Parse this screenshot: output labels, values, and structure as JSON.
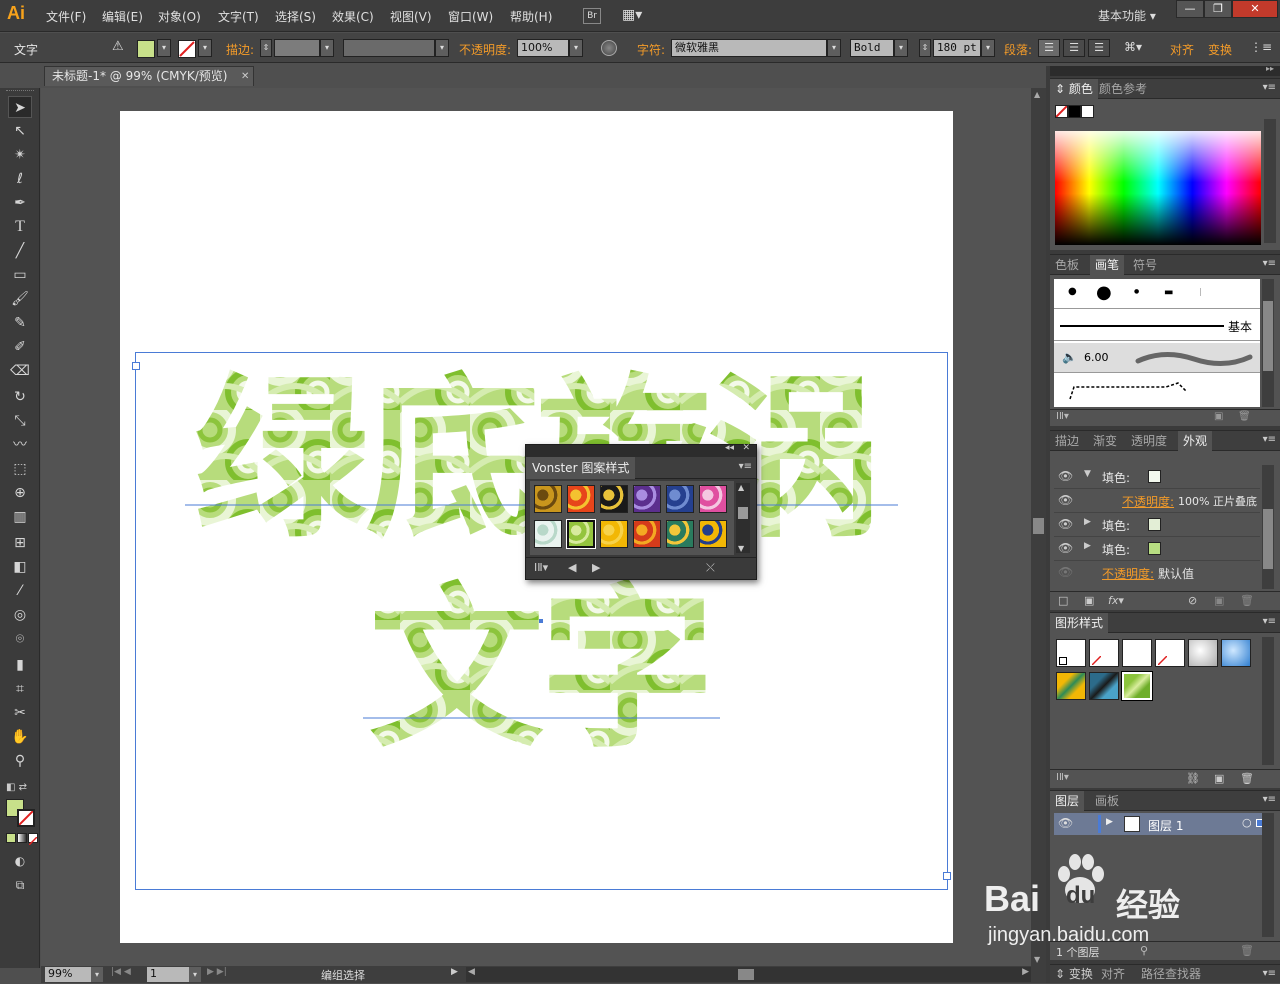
{
  "app": {
    "logo": "Ai",
    "menus": [
      "文件(F)",
      "编辑(E)",
      "对象(O)",
      "文字(T)",
      "选择(S)",
      "效果(C)",
      "视图(V)",
      "窗口(W)",
      "帮助(H)"
    ],
    "bridge_label": "Br",
    "workspace": "基本功能",
    "window_buttons": [
      "—",
      "❐",
      "✕"
    ]
  },
  "control_bar": {
    "mode_label": "文字",
    "stroke_label": "描边:",
    "opacity_label": "不透明度:",
    "opacity_value": "100%",
    "char_label": "字符:",
    "font_family": "微软雅黑",
    "font_style": "Bold",
    "font_size": "180 pt",
    "paragraph_label": "段落:",
    "align_label": "对齐",
    "transform_label": "变换",
    "fill_color": "#c8e08a"
  },
  "document": {
    "tab_title": "未标题-1* @ 99% (CMYK/预览)",
    "close": "✕",
    "headline_line1": "绿底旋涡",
    "headline_line2": "文字"
  },
  "status_bar": {
    "zoom": "99%",
    "page": "1",
    "status": "编组选择"
  },
  "vonster_panel": {
    "title": "Vonster 图案样式",
    "patterns": [
      {
        "colors": [
          "#c9961d",
          "#6b4a0f"
        ]
      },
      {
        "colors": [
          "#e7451b",
          "#f4c230"
        ]
      },
      {
        "colors": [
          "#1a1a1a",
          "#e8c23a"
        ]
      },
      {
        "colors": [
          "#5b2f8e",
          "#a98de0"
        ]
      },
      {
        "colors": [
          "#25408f",
          "#6f8cd0"
        ]
      },
      {
        "colors": [
          "#e04fa0",
          "#f4c6e0"
        ]
      },
      {
        "colors": [
          "#e9f3ef",
          "#b8d8c9"
        ]
      },
      {
        "colors": [
          "#94c43e",
          "#d7ea9e"
        ]
      },
      {
        "colors": [
          "#f2b705",
          "#f7d24a"
        ]
      },
      {
        "colors": [
          "#d53b1b",
          "#f4a922"
        ]
      },
      {
        "colors": [
          "#2a7b5e",
          "#f3c63a"
        ]
      },
      {
        "colors": [
          "#f2b705",
          "#243e8a"
        ]
      }
    ]
  },
  "panels": {
    "color": {
      "tabs": [
        "颜色",
        "颜色参考"
      ]
    },
    "brushes": {
      "tabs": [
        "色板",
        "画笔",
        "符号"
      ],
      "basic_label": "基本",
      "size_value": "6.00"
    },
    "appearance": {
      "tabs": [
        "描边",
        "渐变",
        "透明度",
        "外观"
      ],
      "rows": [
        {
          "label": "填色:"
        },
        {
          "label": "不透明度:",
          "value": "100% 正片叠底"
        },
        {
          "label": "填色:"
        },
        {
          "label": "填色:"
        },
        {
          "label": "不透明度:",
          "value": "默认值"
        }
      ]
    },
    "graphic_styles": {
      "tabs": [
        "图形样式"
      ]
    },
    "layers": {
      "tabs": [
        "图层",
        "画板"
      ],
      "layer_name": "图层 1",
      "count": "1 个图层"
    },
    "bottom": {
      "tabs": [
        "变换",
        "对齐",
        "路径查找器"
      ]
    }
  },
  "watermark": {
    "brand": "Bai",
    "brand2": "du",
    "label": "经验",
    "url": "jingyan.baidu.com"
  },
  "colors": {
    "accent": "#f39b29",
    "selection": "#4a7bd6",
    "green": "#a6d15a"
  }
}
